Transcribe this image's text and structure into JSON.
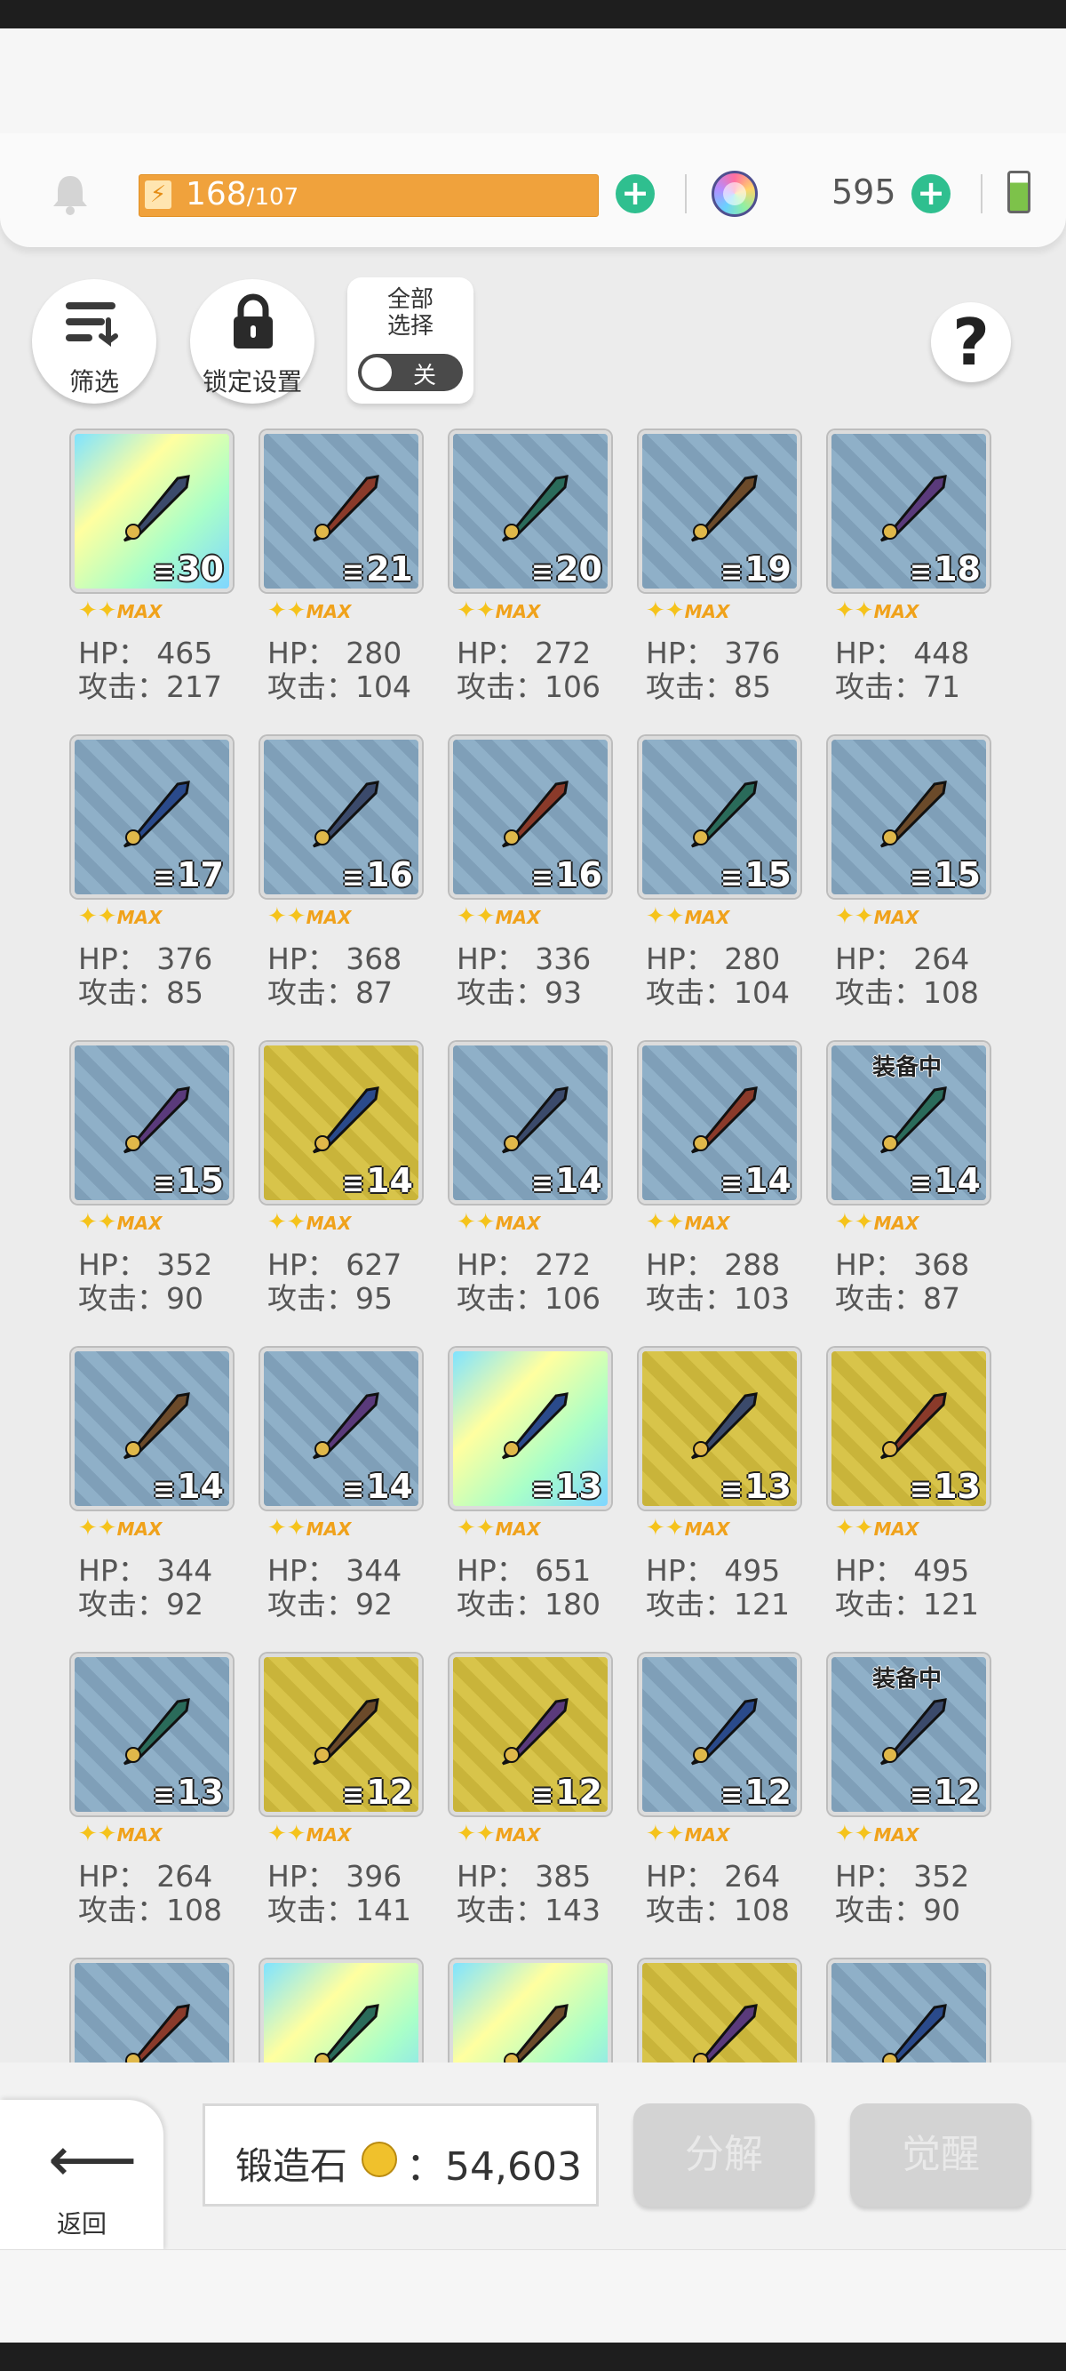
{
  "header": {
    "energy_current": "168",
    "energy_max": "/107",
    "energy_bolt": "⚡",
    "gem_count": "595",
    "plus_symbol": "+",
    "accent_green": "#2fbf8f",
    "energy_color": "#f0a23c"
  },
  "controls": {
    "filter_label": "筛选",
    "lock_label": "锁定设置",
    "select_all_title": "全部\n选择",
    "toggle_state": "关",
    "help_symbol": "?"
  },
  "items": [
    {
      "count": "30",
      "stars": "✦✦",
      "max": "MAX",
      "hp": "HP： 465",
      "atk": "攻击：217",
      "bg": "holo",
      "icon": "sword-icon"
    },
    {
      "count": "21",
      "stars": "✦✦",
      "max": "MAX",
      "hp": "HP： 280",
      "atk": "攻击：104",
      "bg": "blue",
      "icon": "spear-icon"
    },
    {
      "count": "20",
      "stars": "✦✦",
      "max": "MAX",
      "hp": "HP： 272",
      "atk": "攻击：106",
      "bg": "blue",
      "icon": "scythe-icon"
    },
    {
      "count": "19",
      "stars": "✦✦",
      "max": "MAX",
      "hp": "HP： 376",
      "atk": "攻击：85",
      "bg": "blue",
      "icon": "bow-icon"
    },
    {
      "count": "18",
      "stars": "✦✦",
      "max": "MAX",
      "hp": "HP： 448",
      "atk": "攻击：71",
      "bg": "blue",
      "icon": "shuriken-icon"
    },
    {
      "count": "17",
      "stars": "✦✦",
      "max": "MAX",
      "hp": "HP： 376",
      "atk": "攻击：85",
      "bg": "blue",
      "icon": "tome-icon"
    },
    {
      "count": "16",
      "stars": "✦✦",
      "max": "MAX",
      "hp": "HP： 368",
      "atk": "攻击：87",
      "bg": "blue",
      "icon": "crossbow-icon"
    },
    {
      "count": "16",
      "stars": "✦✦",
      "max": "MAX",
      "hp": "HP： 336",
      "atk": "攻击：93",
      "bg": "blue",
      "icon": "gauntlet-icon"
    },
    {
      "count": "15",
      "stars": "✦✦",
      "max": "MAX",
      "hp": "HP： 280",
      "atk": "攻击：104",
      "bg": "blue",
      "icon": "dagger-icon"
    },
    {
      "count": "15",
      "stars": "✦✦",
      "max": "MAX",
      "hp": "HP： 264",
      "atk": "攻击：108",
      "bg": "blue",
      "icon": "curved-blade-icon"
    },
    {
      "count": "15",
      "stars": "✦✦",
      "max": "MAX",
      "hp": "HP： 352",
      "atk": "攻击：90",
      "bg": "blue",
      "icon": "claw-icon"
    },
    {
      "count": "14",
      "stars": "✦✦",
      "max": "MAX",
      "hp": "HP： 627",
      "atk": "攻击：95",
      "bg": "gold",
      "icon": "crystal-icon"
    },
    {
      "count": "14",
      "stars": "✦✦",
      "max": "MAX",
      "hp": "HP： 272",
      "atk": "攻击：106",
      "bg": "blue",
      "icon": "short-sword-icon"
    },
    {
      "count": "14",
      "stars": "✦✦",
      "max": "MAX",
      "hp": "HP： 288",
      "atk": "攻击：103",
      "bg": "blue",
      "icon": "kunai-icon"
    },
    {
      "count": "14",
      "stars": "✦✦",
      "max": "MAX",
      "hp": "HP： 368",
      "atk": "攻击：87",
      "bg": "blue",
      "icon": "red-book-icon",
      "equipped": "装备中"
    },
    {
      "count": "14",
      "stars": "✦✦",
      "max": "MAX",
      "hp": "HP： 344",
      "atk": "攻击：92",
      "bg": "blue",
      "icon": "green-gauntlet-icon"
    },
    {
      "count": "14",
      "stars": "✦✦",
      "max": "MAX",
      "hp": "HP： 344",
      "atk": "攻击：92",
      "bg": "blue",
      "icon": "red-gauntlet-icon"
    },
    {
      "count": "13",
      "stars": "✦✦",
      "max": "MAX",
      "hp": "HP： 651",
      "atk": "攻击：180",
      "bg": "holo",
      "icon": "horned-mask-icon"
    },
    {
      "count": "13",
      "stars": "✦✦",
      "max": "MAX",
      "hp": "HP： 495",
      "atk": "攻击：121",
      "bg": "gold",
      "icon": "blue-bow-icon"
    },
    {
      "count": "13",
      "stars": "✦✦",
      "max": "MAX",
      "hp": "HP： 495",
      "atk": "攻击：121",
      "bg": "gold",
      "icon": "fire-gauntlet-icon"
    },
    {
      "count": "13",
      "stars": "✦✦",
      "max": "MAX",
      "hp": "HP： 264",
      "atk": "攻击：108",
      "bg": "blue",
      "icon": "axe-icon"
    },
    {
      "count": "12",
      "stars": "✦✦",
      "max": "MAX",
      "hp": "HP： 396",
      "atk": "攻击：141",
      "bg": "gold",
      "icon": "gold-spear-icon"
    },
    {
      "count": "12",
      "stars": "✦✦",
      "max": "MAX",
      "hp": "HP： 385",
      "atk": "攻击：143",
      "bg": "gold",
      "icon": "halberd-icon"
    },
    {
      "count": "12",
      "stars": "✦✦",
      "max": "MAX",
      "hp": "HP： 264",
      "atk": "攻击：108",
      "bg": "blue",
      "icon": "flame-sword-icon"
    },
    {
      "count": "12",
      "stars": "✦✦",
      "max": "MAX",
      "hp": "HP： 352",
      "atk": "攻击：90",
      "bg": "blue",
      "icon": "gold-book-icon",
      "equipped": "装备中"
    },
    {
      "count": "",
      "stars": "",
      "max": "",
      "hp": "",
      "atk": "",
      "bg": "blue",
      "icon": "winged-helm-icon"
    },
    {
      "count": "",
      "stars": "",
      "max": "",
      "hp": "",
      "atk": "",
      "bg": "holo",
      "icon": "broadsword-icon"
    },
    {
      "count": "",
      "stars": "",
      "max": "",
      "hp": "",
      "atk": "",
      "bg": "holo",
      "icon": "dark-cloak-icon"
    },
    {
      "count": "",
      "stars": "",
      "max": "",
      "hp": "",
      "atk": "",
      "bg": "gold",
      "icon": "green-orb-book-icon"
    },
    {
      "count": "",
      "stars": "",
      "max": "",
      "hp": "",
      "atk": "",
      "bg": "blue",
      "icon": "pickaxe-icon"
    }
  ],
  "footer": {
    "back_label": "返回",
    "forge_stone_label": "锻造石",
    "forge_stone_value": "：54,603",
    "disassemble_label": "分解",
    "awaken_label": "觉醒"
  }
}
